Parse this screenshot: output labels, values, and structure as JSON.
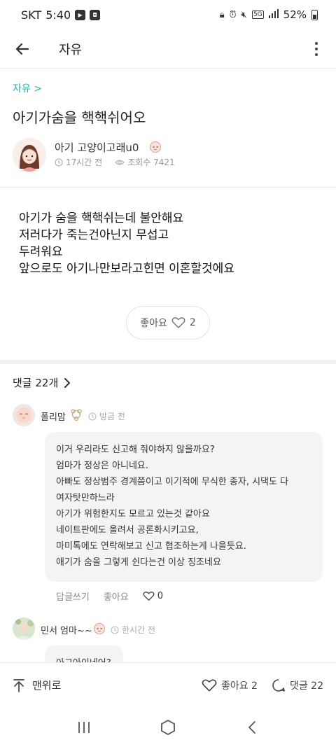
{
  "status_bar": {
    "carrier": "SKT",
    "time": "5:40",
    "battery": "52%",
    "network": "5G"
  },
  "app_bar": {
    "title": "자유"
  },
  "post": {
    "breadcrumb": "자유 >",
    "title": "아기가숨을 핵핵쉬어오",
    "author": "아기 고양이고래u0",
    "time_ago": "17시간 전",
    "views": "조회수 7421",
    "body_lines": [
      "아기가 숨을 핵핵쉬는데 불안해요",
      "저러다가 죽는건아닌지 무섭고",
      "두려워요",
      "앞으로도 아기나만보라고힌면 이혼할것에요"
    ],
    "like_label": "좋아요",
    "like_count": "2"
  },
  "comments": {
    "header": "댓글 22개",
    "items": [
      {
        "author": "폴리맘",
        "time_ago": "방금 전",
        "lines": [
          "이거 우리라도 신고해 줘야하지 않을까요?",
          "엄마가 정상은 아니네요.",
          "아빠도 정상범주 경계쯤이고 이기적에 무식한 종자, 시댁도 다",
          "여자탓만하느라",
          "아기가 위험한지도 모르고 있는것 같아요",
          "네이트판에도 올려서 공론화시키고요,",
          "마미톡에도 연락해보고 신고 협조하는게 나을듯요.",
          "애기가 숨을 그렇게 쉰다는건 이상 징조네요"
        ],
        "reply_label": "답글쓰기",
        "like_label": "좋아요",
        "like_count": "0"
      },
      {
        "author": "민서 엄마~~",
        "time_ago": "한시간 전",
        "partial_text": "아그아이네어?"
      }
    ]
  },
  "bottom_bar": {
    "to_top": "맨위로",
    "like": "좋아요 2",
    "comments": "댓글 22"
  },
  "colors": {
    "accent": "#1fb5b0",
    "text": "#222222",
    "muted": "#999999",
    "bubble": "#f4f4f4"
  }
}
